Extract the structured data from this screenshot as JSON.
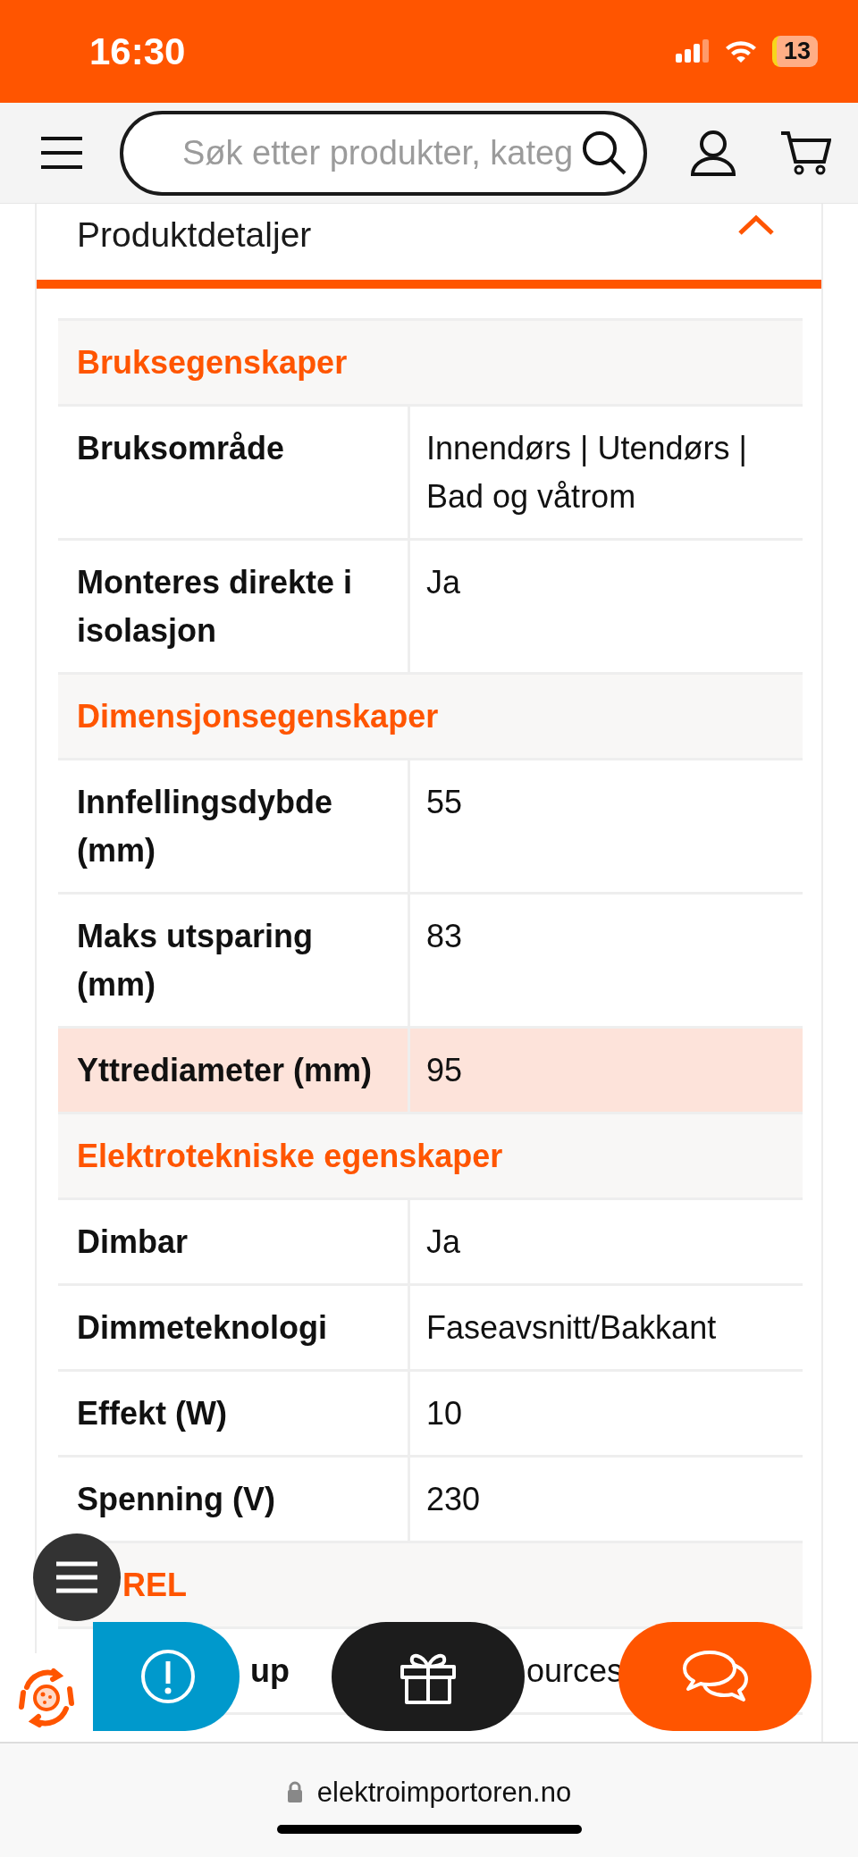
{
  "status_bar": {
    "time": "16:30",
    "battery": "13"
  },
  "header": {
    "search": {
      "placeholder": "Søk etter produkter, kateg"
    }
  },
  "section": {
    "title": "Produktdetaljer",
    "expanded": true
  },
  "table": {
    "rows": [
      {
        "kind": "group",
        "label": "Bruksegenskaper"
      },
      {
        "kind": "row",
        "label": "Bruksområde",
        "value": "Innendørs | Utendørs | Bad og våtrom",
        "highlighted": false
      },
      {
        "kind": "row",
        "label": "Monteres direkte i isolasjon",
        "value": "Ja",
        "highlighted": false
      },
      {
        "kind": "group",
        "label": "Dimensjonsegenskaper"
      },
      {
        "kind": "row",
        "label": "Innfellingsdybde (mm)",
        "value": "55",
        "highlighted": false
      },
      {
        "kind": "row",
        "label": "Maks utsparing (mm)",
        "value": "83",
        "highlighted": false
      },
      {
        "kind": "row",
        "label": "Yttrediameter (mm)",
        "value": "95",
        "highlighted": true
      },
      {
        "kind": "group",
        "label": "Elektrotekniske egenskaper"
      },
      {
        "kind": "row",
        "label": "Dimbar",
        "value": "Ja",
        "highlighted": false
      },
      {
        "kind": "row",
        "label": "Dimmeteknologi",
        "value": "Faseavsnitt/Bakkant",
        "highlighted": false
      },
      {
        "kind": "row",
        "label": "Effekt (W)",
        "value": "10",
        "highlighted": false
      },
      {
        "kind": "row",
        "label": "Spenning (V)",
        "value": "230",
        "highlighted": false
      },
      {
        "kind": "group_covered",
        "label": "REL"
      },
      {
        "kind": "row_covered",
        "label": "up",
        "value": "ources",
        "highlighted": false
      }
    ]
  },
  "browser": {
    "url": "elektroimportoren.no"
  }
}
